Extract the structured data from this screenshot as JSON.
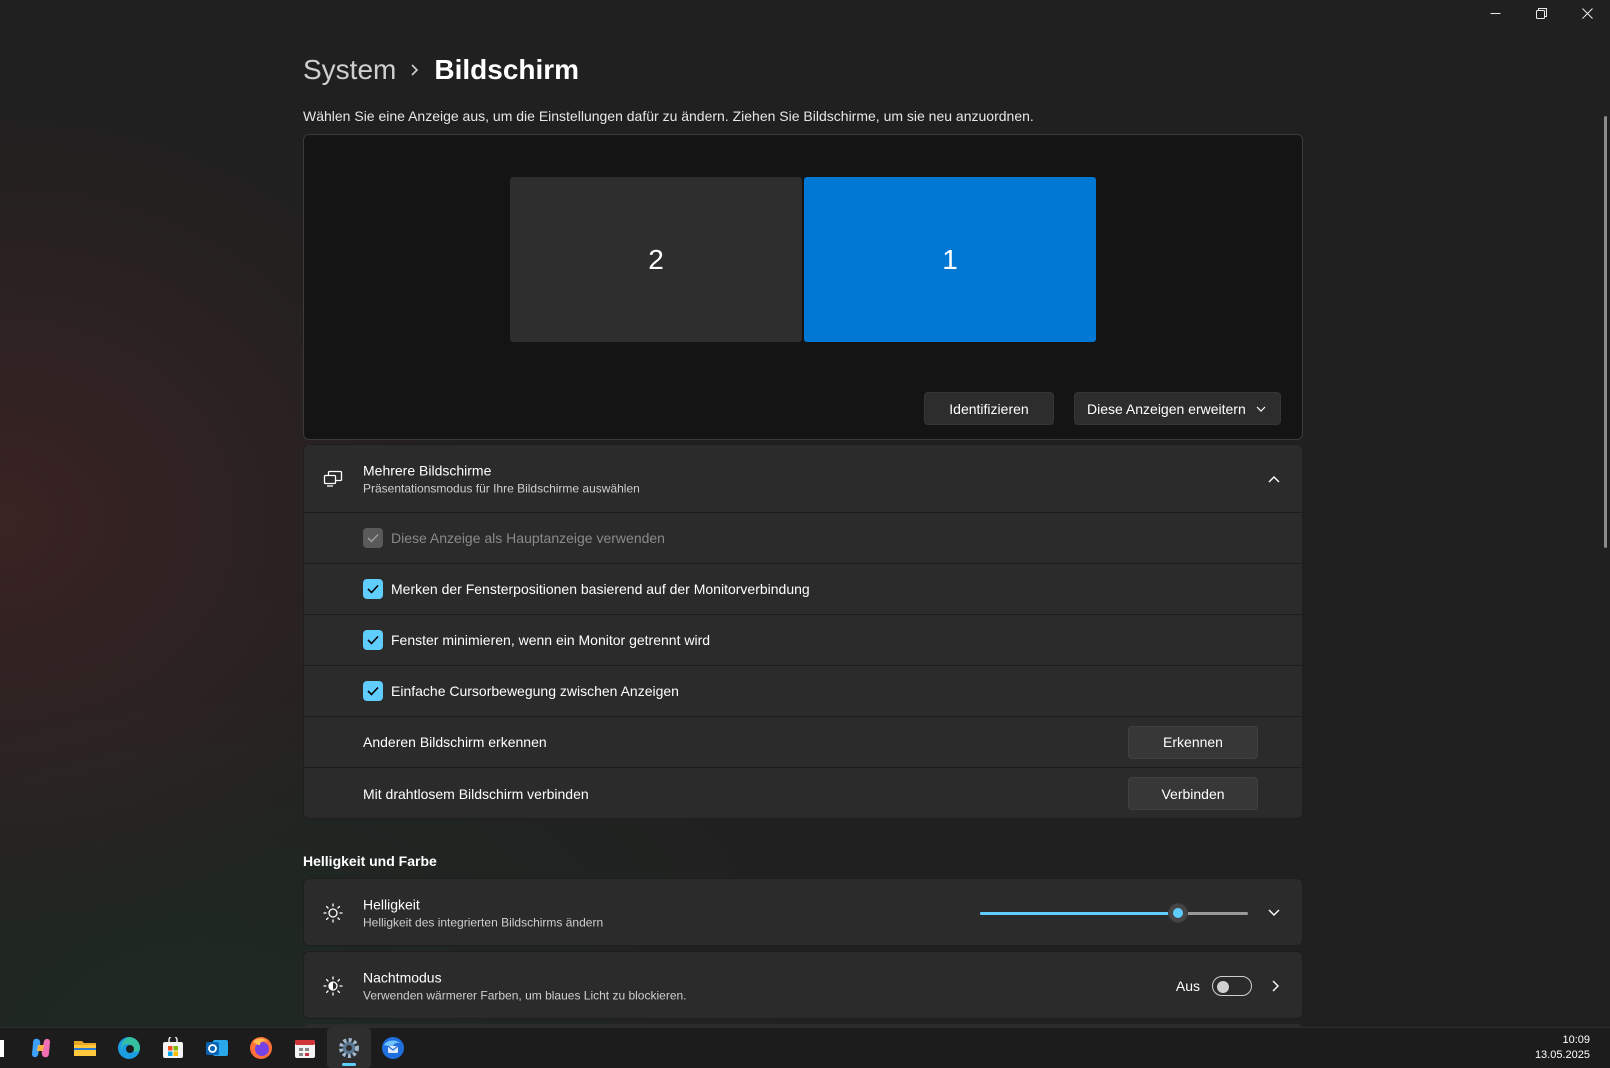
{
  "breadcrumb": {
    "parent": "System",
    "current": "Bildschirm"
  },
  "instructions": "Wählen Sie eine Anzeige aus, um die Einstellungen dafür zu ändern. Ziehen Sie Bildschirme, um sie neu anzuordnen.",
  "monitors": {
    "secondary_label": "2",
    "primary_label": "1",
    "accent": "#0078d4"
  },
  "display_area": {
    "identify_label": "Identifizieren",
    "mode_label": "Diese Anzeigen erweitern"
  },
  "multi_display": {
    "title": "Mehrere Bildschirme",
    "subtitle": "Präsentationsmodus für Ihre Bildschirme auswählen",
    "options": {
      "main_display": "Diese Anzeige als Hauptanzeige verwenden",
      "remember_positions": "Merken der Fensterpositionen basierend auf der Monitorverbindung",
      "minimize_windows": "Fenster minimieren, wenn ein Monitor getrennt wird",
      "easy_cursor": "Einfache Cursorbewegung zwischen Anzeigen"
    },
    "detect_label": "Anderen Bildschirm erkennen",
    "detect_button": "Erkennen",
    "wireless_label": "Mit drahtlosem Bildschirm verbinden",
    "wireless_button": "Verbinden"
  },
  "section_brightness_color": "Helligkeit und Farbe",
  "brightness": {
    "title": "Helligkeit",
    "subtitle": "Helligkeit des integrierten Bildschirms ändern",
    "value_fraction": 0.74
  },
  "night_mode": {
    "title": "Nachtmodus",
    "subtitle": "Verwenden wärmerer Farben, um blaues Licht zu blockieren.",
    "state_label": "Aus"
  },
  "taskbar": {
    "icons": [
      "copilot-icon",
      "file-explorer-icon",
      "edge-icon",
      "store-icon",
      "outlook-icon",
      "firefox-icon",
      "calendar-app-icon",
      "settings-icon",
      "thunderbird-icon"
    ],
    "time": "10:09",
    "date": "13.05.2025"
  },
  "colors": {
    "accent": "#60cdff",
    "background": "#202020",
    "card": "#2b2b2b"
  }
}
